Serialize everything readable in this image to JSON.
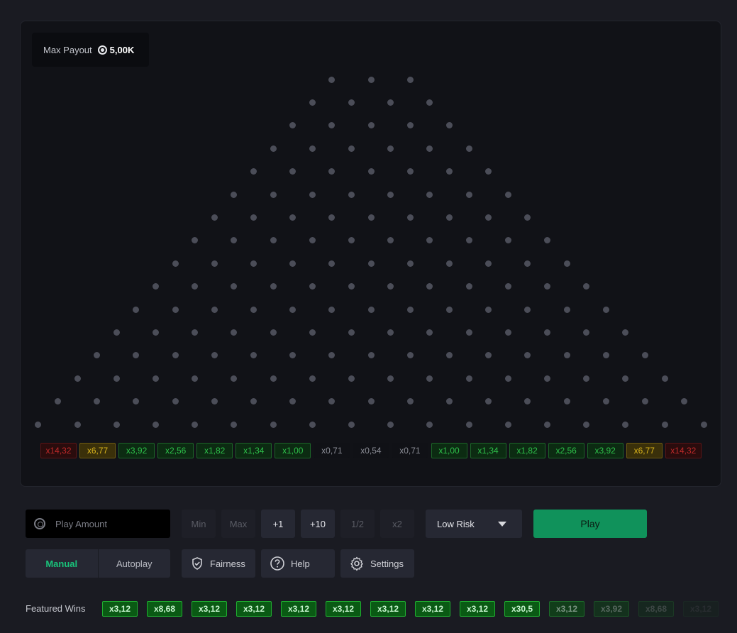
{
  "max_payout": {
    "label": "Max Payout",
    "value": "5,00K"
  },
  "board": {
    "rows": 16
  },
  "multipliers": [
    {
      "text": "x14,32",
      "tone": "red"
    },
    {
      "text": "x6,77",
      "tone": "gold"
    },
    {
      "text": "x3,92",
      "tone": "green"
    },
    {
      "text": "x2,56",
      "tone": "green"
    },
    {
      "text": "x1,82",
      "tone": "green"
    },
    {
      "text": "x1,34",
      "tone": "green"
    },
    {
      "text": "x1,00",
      "tone": "green"
    },
    {
      "text": "x0,71",
      "tone": "gray"
    },
    {
      "text": "x0,54",
      "tone": "gray"
    },
    {
      "text": "x0,71",
      "tone": "gray"
    },
    {
      "text": "x1,00",
      "tone": "green"
    },
    {
      "text": "x1,34",
      "tone": "green"
    },
    {
      "text": "x1,82",
      "tone": "green"
    },
    {
      "text": "x2,56",
      "tone": "green"
    },
    {
      "text": "x3,92",
      "tone": "green"
    },
    {
      "text": "x6,77",
      "tone": "gold"
    },
    {
      "text": "x14,32",
      "tone": "red"
    }
  ],
  "controls": {
    "play_amount_placeholder": "Play Amount",
    "min": "Min",
    "max": "Max",
    "plus1": "+1",
    "plus10": "+10",
    "half": "1/2",
    "double": "x2",
    "risk": "Low Risk",
    "play": "Play",
    "manual": "Manual",
    "autoplay": "Autoplay",
    "fairness": "Fairness",
    "help": "Help",
    "settings": "Settings"
  },
  "featured": {
    "label": "Featured Wins",
    "wins": [
      "x3,12",
      "x8,68",
      "x3,12",
      "x3,12",
      "x3,12",
      "x3,12",
      "x3,12",
      "x3,12",
      "x3,12",
      "x30,5",
      "x3,12",
      "x3,92",
      "x8,68",
      "x3,12"
    ]
  },
  "colors": {
    "accent": "#19c27a",
    "play_button": "#10925b",
    "peg": "#4b4d58"
  },
  "icons": {
    "chip": "chip-icon",
    "fairness": "shield-check-icon",
    "help": "question-circle-icon",
    "settings": "gear-icon",
    "risk": "caret-down-icon"
  }
}
